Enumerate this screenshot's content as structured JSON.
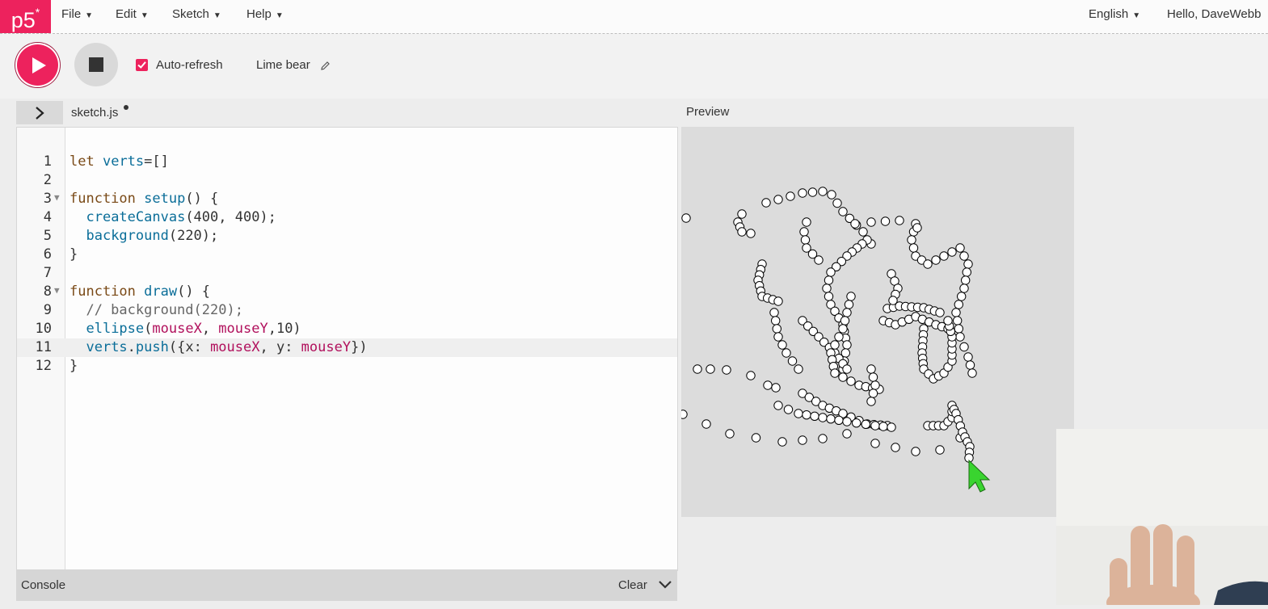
{
  "app": {
    "logo": "p5",
    "logo_star": "*"
  },
  "nav": {
    "menus": [
      "File",
      "Edit",
      "Sketch",
      "Help"
    ],
    "language": "English",
    "user_greeting": "Hello, DaveWebb"
  },
  "toolbar": {
    "autorefresh_label": "Auto-refresh",
    "autorefresh_checked": true,
    "sketch_name": "Lime bear"
  },
  "editor": {
    "filename": "sketch.js",
    "unsaved": true,
    "active_line": 11,
    "lines": [
      {
        "n": "1",
        "text": "let verts=[]"
      },
      {
        "n": "2",
        "text": ""
      },
      {
        "n": "3",
        "text": "function setup() {"
      },
      {
        "n": "4",
        "text": "  createCanvas(400, 400);"
      },
      {
        "n": "5",
        "text": "  background(220);"
      },
      {
        "n": "6",
        "text": "}"
      },
      {
        "n": "7",
        "text": ""
      },
      {
        "n": "8",
        "text": "function draw() {"
      },
      {
        "n": "9",
        "text": "  // background(220);"
      },
      {
        "n": "10",
        "text": "  ellipse(mouseX, mouseY,10)"
      },
      {
        "n": "11",
        "text": "  verts.push({x: mouseX, y: mouseY})"
      },
      {
        "n": "12",
        "text": "}"
      }
    ]
  },
  "preview": {
    "label": "Preview"
  },
  "console": {
    "label": "Console",
    "clear_label": "Clear"
  },
  "colors": {
    "accent": "#ed225d",
    "canvas_bg": "#dcdcdc",
    "cursor": "#39d42f"
  },
  "icons": [
    "play-icon",
    "stop-icon",
    "check-icon",
    "pencil-icon",
    "chevron-right-icon",
    "chevron-down-icon",
    "caret-down-icon",
    "cursor-arrow-icon"
  ]
}
